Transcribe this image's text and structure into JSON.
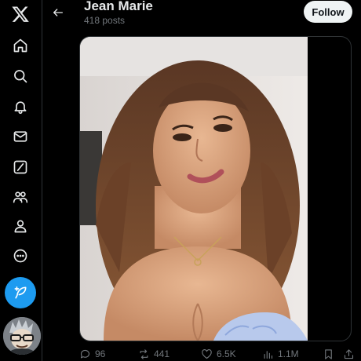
{
  "header": {
    "title": "Jean Marie",
    "posts_count": "418 posts",
    "follow_label": "Follow"
  },
  "nav": {
    "items": [
      "x-logo",
      "home-icon",
      "search-icon",
      "bell-icon",
      "mail-icon",
      "grok-icon",
      "communities-icon",
      "profile-icon",
      "more-icon"
    ],
    "post_button_icon": "feather-plus-icon",
    "avatar": "user-avatar"
  },
  "actions": {
    "replies": "96",
    "reposts": "441",
    "likes": "6.5K",
    "views": "1.1M"
  },
  "colors": {
    "background": "#000000",
    "accent": "#1d9bf0",
    "text": "#e7e9ea",
    "muted": "#71767b"
  }
}
